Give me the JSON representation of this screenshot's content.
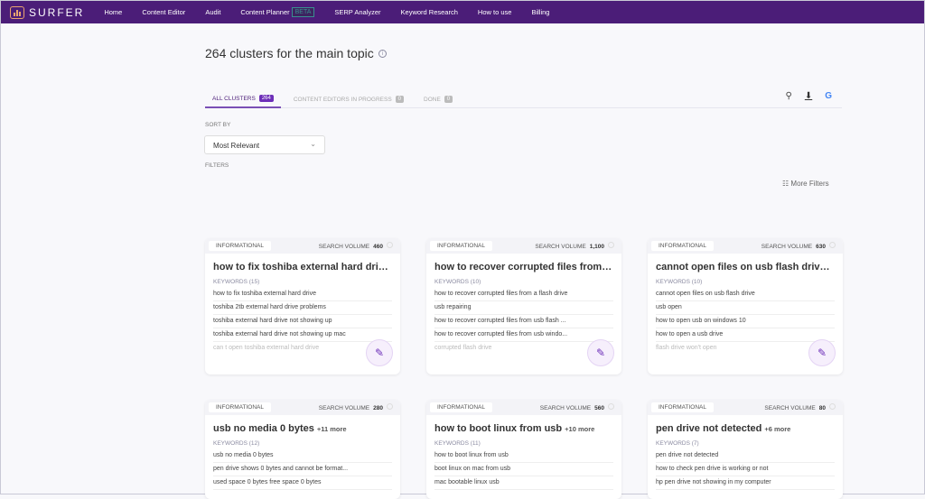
{
  "nav": {
    "brand": "SURFER",
    "items": [
      "Home",
      "Content Editor",
      "Audit",
      "Content Planner",
      "SERP Analyzer",
      "Keyword Research",
      "How to use",
      "Billing"
    ],
    "beta": "BETA"
  },
  "page": {
    "title": "264 clusters for the main topic"
  },
  "tabs": [
    {
      "label": "ALL CLUSTERS",
      "count": "264"
    },
    {
      "label": "CONTENT EDITORS IN PROGRESS",
      "count": "0"
    },
    {
      "label": "DONE",
      "count": "0"
    }
  ],
  "sort": {
    "label": "SORT BY",
    "value": "Most Relevant"
  },
  "filters": {
    "label": "FILTERS",
    "more": "More Filters"
  },
  "colors": {
    "brand": "#4b1d78",
    "accent": "#6d2fb8"
  },
  "cards": [
    {
      "intent": "INFORMATIONAL",
      "vol_label": "SEARCH VOLUME",
      "volume": "460",
      "title": "how to fix toshiba external hard driv...",
      "more": "",
      "kw_label": "KEYWORDS (15)",
      "keywords": [
        "how to fix toshiba external hard drive",
        "toshiba 2tb external hard drive problems",
        "toshiba external hard drive not showing up",
        "toshiba external hard drive not showing up mac",
        "can t open toshiba external hard drive"
      ]
    },
    {
      "intent": "INFORMATIONAL",
      "vol_label": "SEARCH VOLUME",
      "volume": "1,100",
      "title": "how to recover corrupted files from ...",
      "more": "",
      "kw_label": "KEYWORDS (10)",
      "keywords": [
        "how to recover corrupted files from a flash drive",
        "usb repairing",
        "how to recover corrupted files from usb flash ...",
        "how to recover corrupted files from usb windo...",
        "corrupted flash drive"
      ]
    },
    {
      "intent": "INFORMATIONAL",
      "vol_label": "SEARCH VOLUME",
      "volume": "630",
      "title": "cannot open files on usb flash drive...",
      "more": "",
      "kw_label": "KEYWORDS (10)",
      "keywords": [
        "cannot open files on usb flash drive",
        "usb open",
        "how to open usb on windows 10",
        "how to open a usb drive",
        "flash drive won't open"
      ]
    },
    {
      "intent": "INFORMATIONAL",
      "vol_label": "SEARCH VOLUME",
      "volume": "280",
      "title": "usb no media 0 bytes",
      "more": "+11 more",
      "kw_label": "KEYWORDS (12)",
      "keywords": [
        "usb no media 0 bytes",
        "pen drive shows 0 bytes and cannot be format...",
        "used space 0 bytes free space 0 bytes"
      ]
    },
    {
      "intent": "INFORMATIONAL",
      "vol_label": "SEARCH VOLUME",
      "volume": "560",
      "title": "how to boot linux from usb",
      "more": "+10 more",
      "kw_label": "KEYWORDS (11)",
      "keywords": [
        "how to boot linux from usb",
        "boot linux on mac from usb",
        "mac bootable linux usb"
      ]
    },
    {
      "intent": "INFORMATIONAL",
      "vol_label": "SEARCH VOLUME",
      "volume": "80",
      "title": "pen drive not detected",
      "more": "+6 more",
      "kw_label": "KEYWORDS (7)",
      "keywords": [
        "pen drive not detected",
        "how to check pen drive is working or not",
        "hp pen drive not showing in my computer"
      ]
    }
  ]
}
